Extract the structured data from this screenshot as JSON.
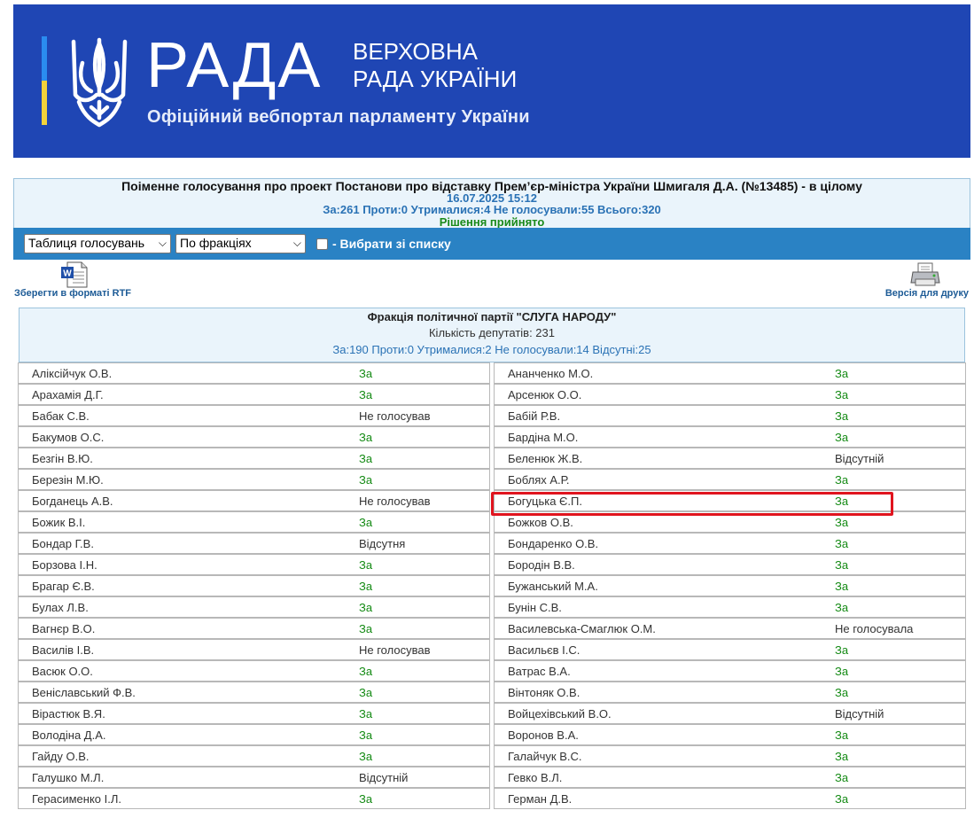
{
  "header": {
    "brand": "РАДА",
    "brand_line1": "ВЕРХОВНА",
    "brand_line2": "РАДА УКРАЇНИ",
    "tagline": "Офіційний вебпортал парламенту України",
    "colors": {
      "background": "#1f46b4",
      "stripe_blue": "#2a8cf0",
      "stripe_yellow": "#f3d33b"
    }
  },
  "vote": {
    "title": "Поіменне голосування про проект Постанови про відставку Прем’єр-міністра України Шмигаля Д.А. (№13485) - в цілому",
    "datetime": "16.07.2025 15:12",
    "counts": "За:261 Проти:0 Утрималися:4 Не голосували:55 Всього:320",
    "result": "Рішення прийнято"
  },
  "toolbar": {
    "view_select": "Таблиця голосувань",
    "group_select": "По фракціях",
    "checkbox_label": "- Вибрати зі списку"
  },
  "actions": {
    "save_rtf": "Зберегти в форматі RTF",
    "print_version": "Версія для друку"
  },
  "faction": {
    "name": "Фракція політичної партії \"СЛУГА НАРОДУ\"",
    "count": "Кількість депутатів: 231",
    "stats": "За:190 Проти:0 Утрималися:2 Не голосували:14 Відсутні:25"
  },
  "deputies_left": [
    {
      "name": "Аліксійчук О.В.",
      "vote": "За"
    },
    {
      "name": "Арахамія Д.Г.",
      "vote": "За"
    },
    {
      "name": "Бабак С.В.",
      "vote": "Не голосував"
    },
    {
      "name": "Бакумов О.С.",
      "vote": "За"
    },
    {
      "name": "Безгін В.Ю.",
      "vote": "За"
    },
    {
      "name": "Березін М.Ю.",
      "vote": "За"
    },
    {
      "name": "Богданець А.В.",
      "vote": "Не голосував"
    },
    {
      "name": "Божик В.І.",
      "vote": "За"
    },
    {
      "name": "Бондар Г.В.",
      "vote": "Відсутня"
    },
    {
      "name": "Борзова І.Н.",
      "vote": "За"
    },
    {
      "name": "Брагар Є.В.",
      "vote": "За"
    },
    {
      "name": "Булах Л.В.",
      "vote": "За"
    },
    {
      "name": "Вагнєр В.О.",
      "vote": "За"
    },
    {
      "name": "Василів І.В.",
      "vote": "Не голосував"
    },
    {
      "name": "Васюк О.О.",
      "vote": "За"
    },
    {
      "name": "Веніславський Ф.В.",
      "vote": "За"
    },
    {
      "name": "Вірастюк В.Я.",
      "vote": "За"
    },
    {
      "name": "Володіна Д.А.",
      "vote": "За"
    },
    {
      "name": "Гайду О.В.",
      "vote": "За"
    },
    {
      "name": "Галушко М.Л.",
      "vote": "Відсутній"
    },
    {
      "name": "Герасименко І.Л.",
      "vote": "За"
    }
  ],
  "deputies_right": [
    {
      "name": "Ананченко М.О.",
      "vote": "За"
    },
    {
      "name": "Арсенюк О.О.",
      "vote": "За"
    },
    {
      "name": "Бабій Р.В.",
      "vote": "За"
    },
    {
      "name": "Бардіна М.О.",
      "vote": "За"
    },
    {
      "name": "Беленюк Ж.В.",
      "vote": "Відсутній"
    },
    {
      "name": "Боблях А.Р.",
      "vote": "За"
    },
    {
      "name": "Богуцька Є.П.",
      "vote": "За"
    },
    {
      "name": "Божков О.В.",
      "vote": "За"
    },
    {
      "name": "Бондаренко О.В.",
      "vote": "За"
    },
    {
      "name": "Бородін В.В.",
      "vote": "За"
    },
    {
      "name": "Бужанський М.А.",
      "vote": "За"
    },
    {
      "name": "Бунін С.В.",
      "vote": "За"
    },
    {
      "name": "Василевська-Смаглюк О.М.",
      "vote": "Не голосувала"
    },
    {
      "name": "Васильєв І.С.",
      "vote": "За"
    },
    {
      "name": "Ватрас В.А.",
      "vote": "За"
    },
    {
      "name": "Вінтоняк О.В.",
      "vote": "За"
    },
    {
      "name": "Войцехівський В.О.",
      "vote": "Відсутній"
    },
    {
      "name": "Воронов В.А.",
      "vote": "За"
    },
    {
      "name": "Галайчук В.С.",
      "vote": "За"
    },
    {
      "name": "Гевко В.Л.",
      "vote": "За"
    },
    {
      "name": "Герман Д.В.",
      "vote": "За"
    }
  ],
  "colors": {
    "vote_for": "#148a14",
    "toolbar": "#2a82c4",
    "link": "#1d5b96",
    "highlight": "#e0141e"
  }
}
